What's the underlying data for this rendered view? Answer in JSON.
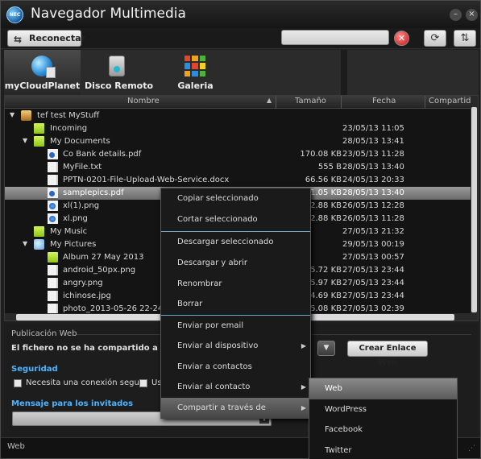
{
  "window": {
    "title": "Navegador Multimedia",
    "logo_text": "NEC"
  },
  "toolbar": {
    "reconnect_label": "Reconectar",
    "search_value": "",
    "clear_icon": "clear-icon",
    "sync_icon": "sync-icon",
    "swap_icon": "swap-icon"
  },
  "sources": [
    {
      "label": "myCloudPlanet",
      "icon": "cloud-globe-icon"
    },
    {
      "label": "Disco Remoto",
      "icon": "remote-drive-icon"
    },
    {
      "label": "Galeria",
      "icon": "gallery-icon"
    }
  ],
  "columns": {
    "name": "Nombre",
    "size": "Tamaño",
    "date": "Fecha",
    "shared": "Compartido"
  },
  "files": [
    {
      "name": "tef test MyStuff",
      "size": "",
      "date": ""
    },
    {
      "name": "Incoming",
      "size": "",
      "date": "23/05/13 11:05"
    },
    {
      "name": "My Documents",
      "size": "",
      "date": "28/05/13 13:41"
    },
    {
      "name": "Co Bank details.pdf",
      "size": "170.08 KB",
      "date": "23/05/13 11:28"
    },
    {
      "name": "MyFile.txt",
      "size": "555 B",
      "date": "28/05/13 13:40"
    },
    {
      "name": "PPTN-0201-File-Upload-Web-Service.docx",
      "size": "66.56 KB",
      "date": "24/05/13 20:33"
    },
    {
      "name": "samplepics.pdf",
      "size": "1.05 KB",
      "date": "28/05/13 13:40"
    },
    {
      "name": "xl(1).png",
      "size": "2.88 KB",
      "date": "26/05/13 12:28"
    },
    {
      "name": "xl.png",
      "size": "2.88 KB",
      "date": "26/05/13 11:28"
    },
    {
      "name": "My Music",
      "size": "",
      "date": "27/05/13 21:32"
    },
    {
      "name": "My Pictures",
      "size": "",
      "date": "29/05/13 00:19"
    },
    {
      "name": "Album 27 May 2013",
      "size": "",
      "date": "27/05/13 00:57"
    },
    {
      "name": "android_50px.png",
      "size": "5.72 KB",
      "date": "27/05/13 23:44"
    },
    {
      "name": "angry.png",
      "size": "5.97 KB",
      "date": "27/05/13 23:44"
    },
    {
      "name": "ichinose.jpg",
      "size": "4.69 KB",
      "date": "27/05/13 23:44"
    },
    {
      "name": "photo_2013-05-26 22-24-00",
      "size": "5.08 KB",
      "date": "27/05/13 02:39"
    }
  ],
  "web_panel": {
    "title": "Publicación Web",
    "notice": "El fichero no se ha compartido a través d",
    "create_link": "Crear Enlace Web",
    "security_title": "Seguridad",
    "secure_conn": "Necesita una conexión segura",
    "second_option": "Us",
    "guest_message_title": "Mensaje para los invitados",
    "guest_message_value": ""
  },
  "status": {
    "text": "Web"
  },
  "context_menu": {
    "items": [
      {
        "label": "Copiar seleccionado"
      },
      {
        "label": "Cortar seleccionado"
      },
      {
        "label": "Descargar seleccionado"
      },
      {
        "label": "Descargar y abrir"
      },
      {
        "label": "Renombrar"
      },
      {
        "label": "Borrar"
      },
      {
        "label": "Enviar por email"
      },
      {
        "label": "Enviar al dispositivo"
      },
      {
        "label": "Enviar a contactos"
      },
      {
        "label": "Enviar al contacto"
      },
      {
        "label": "Compartir a través de"
      }
    ]
  },
  "share_submenu": {
    "items": [
      {
        "label": "Web"
      },
      {
        "label": "WordPress"
      },
      {
        "label": "Facebook"
      },
      {
        "label": "Twitter"
      }
    ]
  }
}
